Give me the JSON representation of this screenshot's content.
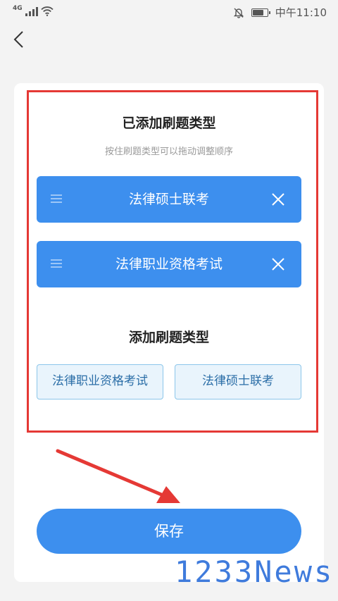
{
  "status_bar": {
    "network": "4G",
    "time": "中午11:10",
    "battery_level": 0.8
  },
  "page": {
    "back_icon": "chevron-left-icon",
    "added_title": "已添加刷题类型",
    "hint": "按住刷题类型可以拖动调整顺序",
    "added_types": [
      {
        "label": "法律硕士联考"
      },
      {
        "label": "法律职业资格考试"
      }
    ],
    "add_title": "添加刷题类型",
    "available_types": [
      {
        "label": "法律职业资格考试"
      },
      {
        "label": "法律硕士联考"
      }
    ],
    "save_label": "保存"
  },
  "annotation": {
    "highlight_color": "#e53935",
    "arrow_color": "#e53935"
  },
  "colors": {
    "accent": "#3d8fee",
    "option_bg": "#e9f4fc",
    "option_border": "#8cc6ea",
    "option_text": "#2b6ea7"
  },
  "watermark": "1233News"
}
